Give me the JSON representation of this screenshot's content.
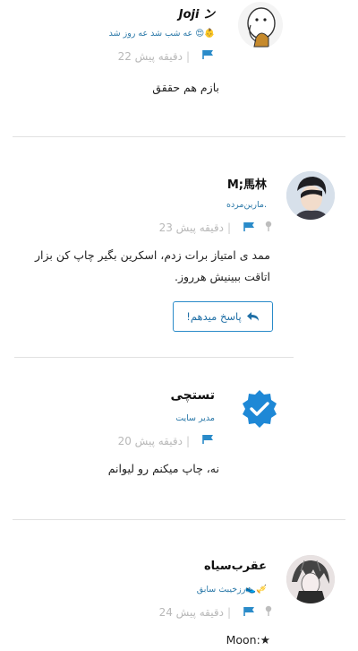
{
  "comments": [
    {
      "name": "Joji ン",
      "subtitle": "عه شب شد عه روز شد 😍👶",
      "time": "22 دقیقه پیش",
      "text": "بازم هم حققق",
      "avatar_icon": "cartoon-avatar"
    },
    {
      "name": "M;馬林",
      "subtitle": "مارین‌مرده.",
      "time": "23 دقیقه پیش",
      "text": "ممد ی امتیاز برات زدم، اسکرین بگیر چاپ کن بزار اتاقت ببینیش هرروز.",
      "reply_label": "پاسخ میدهم!",
      "avatar_icon": "photo-avatar"
    },
    {
      "name": "تستچی",
      "subtitle": "مدیر سایت",
      "time": "20 دقیقه پیش",
      "text": "نه، چاپ میکنم رو لیوانم",
      "avatar_icon": "verified-badge"
    },
    {
      "name": "عقرب‌سیاه",
      "subtitle": "رزخیبث سابق👟🎺",
      "time": "24 دقیقه پیش",
      "text": "★:Moon",
      "avatar_icon": "manga-avatar"
    }
  ],
  "colors": {
    "accent": "#2a8bc9",
    "badge": "#1e88d6"
  }
}
